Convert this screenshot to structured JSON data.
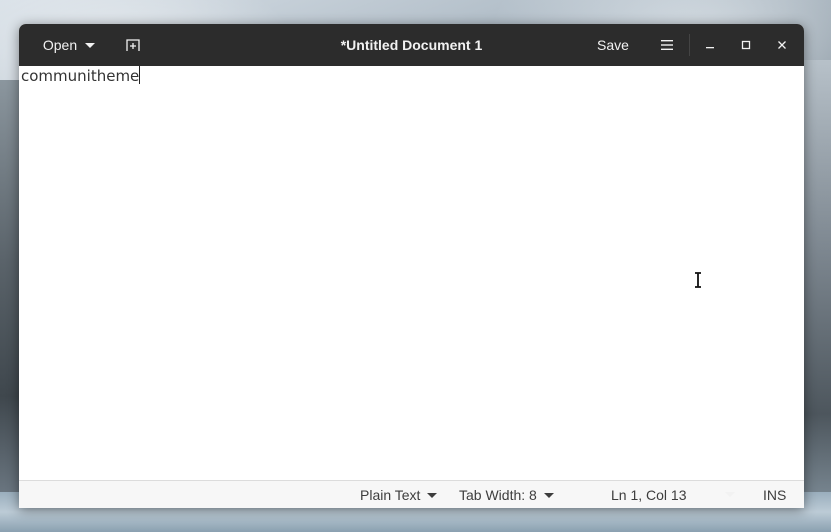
{
  "window": {
    "title": "*Untitled Document 1"
  },
  "headerbar": {
    "open_label": "Open",
    "save_label": "Save",
    "icons": [
      "new-tab-icon",
      "hamburger-menu-icon",
      "minimize-icon",
      "maximize-icon",
      "close-icon"
    ]
  },
  "editor": {
    "content": "communitheme"
  },
  "statusbar": {
    "language": "Plain Text",
    "tab_width": "Tab Width: 8",
    "cursor_position": "Ln 1, Col 13",
    "insert_mode": "INS"
  },
  "colors": {
    "headerbar_bg": "#2c2c2c",
    "headerbar_fg": "#f2f2f2",
    "editor_bg": "#ffffff",
    "statusbar_bg": "#f7f7f7"
  }
}
